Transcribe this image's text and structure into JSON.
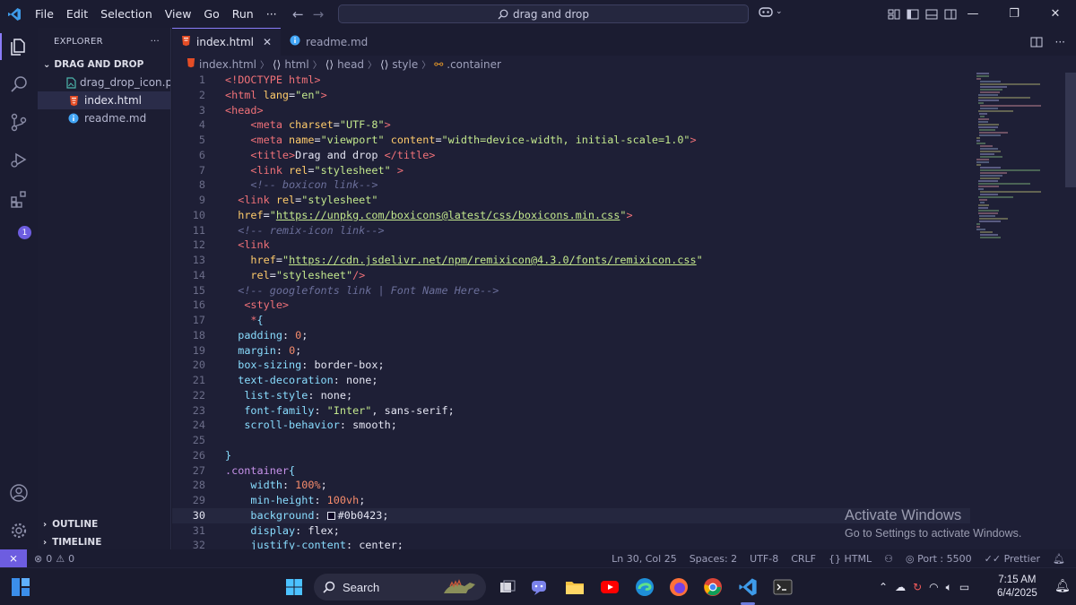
{
  "window": {
    "menu": [
      "File",
      "Edit",
      "Selection",
      "View",
      "Go",
      "Run",
      "···"
    ],
    "search_text": "drag and drop",
    "controls": [
      "—",
      "❐",
      "✕"
    ]
  },
  "explorer": {
    "title": "EXPLORER",
    "more": "···",
    "folder": "DRAG AND DROP",
    "files": [
      {
        "name": "drag_drop_icon.p...",
        "icon": "image-file-icon",
        "active": false
      },
      {
        "name": "index.html",
        "icon": "html-file-icon",
        "active": true
      },
      {
        "name": "readme.md",
        "icon": "info-file-icon",
        "active": false
      }
    ],
    "outline": "OUTLINE",
    "timeline": "TIMELINE",
    "extensions_badge": "1"
  },
  "tabs": [
    {
      "label": "index.html",
      "active": true
    },
    {
      "label": "readme.md",
      "active": false
    }
  ],
  "breadcrumb": [
    "index.html",
    "html",
    "head",
    "style",
    ".container"
  ],
  "editor": {
    "current_line": 30,
    "lines": [
      {
        "n": "1",
        "t": [
          [
            "t-tag",
            "<!DOCTYPE html>"
          ]
        ]
      },
      {
        "n": "2",
        "t": [
          [
            "t-tag",
            "<html "
          ],
          [
            "t-attr",
            "lang"
          ],
          [
            "t-txt",
            "="
          ],
          [
            "t-str",
            "\"en\""
          ],
          [
            "t-tag",
            ">"
          ]
        ]
      },
      {
        "n": "3",
        "t": [
          [
            "t-tag",
            "<head>"
          ]
        ]
      },
      {
        "n": "4",
        "t": [
          [
            "t-txt",
            "    "
          ],
          [
            "t-tag",
            "<meta "
          ],
          [
            "t-attr",
            "charset"
          ],
          [
            "t-txt",
            "="
          ],
          [
            "t-str",
            "\"UTF-8\""
          ],
          [
            "t-tag",
            ">"
          ]
        ]
      },
      {
        "n": "5",
        "t": [
          [
            "t-txt",
            "    "
          ],
          [
            "t-tag",
            "<meta "
          ],
          [
            "t-attr",
            "name"
          ],
          [
            "t-txt",
            "="
          ],
          [
            "t-str",
            "\"viewport\""
          ],
          [
            "t-txt",
            " "
          ],
          [
            "t-attr",
            "content"
          ],
          [
            "t-txt",
            "="
          ],
          [
            "t-str",
            "\"width=device-width, initial-scale=1.0\""
          ],
          [
            "t-tag",
            ">"
          ]
        ]
      },
      {
        "n": "6",
        "t": [
          [
            "t-txt",
            "    "
          ],
          [
            "t-tag",
            "<title>"
          ],
          [
            "t-txt",
            "Drag and drop "
          ],
          [
            "t-tag",
            "</title>"
          ]
        ]
      },
      {
        "n": "7",
        "t": [
          [
            "t-txt",
            "    "
          ],
          [
            "t-tag",
            "<link "
          ],
          [
            "t-attr",
            "rel"
          ],
          [
            "t-txt",
            "="
          ],
          [
            "t-str",
            "\"stylesheet\""
          ],
          [
            "t-txt",
            " "
          ],
          [
            "t-tag",
            ">"
          ]
        ]
      },
      {
        "n": "8",
        "t": [
          [
            "t-txt",
            "    "
          ],
          [
            "t-cmt",
            "<!-- boxicon link-->"
          ]
        ]
      },
      {
        "n": "9",
        "t": [
          [
            "t-txt",
            "  "
          ],
          [
            "t-tag",
            "<link "
          ],
          [
            "t-attr",
            "rel"
          ],
          [
            "t-txt",
            "="
          ],
          [
            "t-str",
            "\"stylesheet\""
          ]
        ]
      },
      {
        "n": "10",
        "t": [
          [
            "t-txt",
            "  "
          ],
          [
            "t-attr",
            "href"
          ],
          [
            "t-txt",
            "="
          ],
          [
            "t-str",
            "\""
          ],
          [
            "t-url",
            "https://unpkg.com/boxicons@latest/css/boxicons.min.css"
          ],
          [
            "t-str",
            "\""
          ],
          [
            "t-tag",
            ">"
          ]
        ]
      },
      {
        "n": "11",
        "t": [
          [
            "t-txt",
            "  "
          ],
          [
            "t-cmt",
            "<!-- remix-icon link-->"
          ]
        ]
      },
      {
        "n": "12",
        "t": [
          [
            "t-txt",
            "  "
          ],
          [
            "t-tag",
            "<link"
          ]
        ]
      },
      {
        "n": "13",
        "t": [
          [
            "t-txt",
            "    "
          ],
          [
            "t-attr",
            "href"
          ],
          [
            "t-txt",
            "="
          ],
          [
            "t-str",
            "\""
          ],
          [
            "t-url",
            "https://cdn.jsdelivr.net/npm/remixicon@4.3.0/fonts/remixicon.css"
          ],
          [
            "t-str",
            "\""
          ]
        ]
      },
      {
        "n": "14",
        "t": [
          [
            "t-txt",
            "    "
          ],
          [
            "t-attr",
            "rel"
          ],
          [
            "t-txt",
            "="
          ],
          [
            "t-str",
            "\"stylesheet\""
          ],
          [
            "t-tag",
            "/>"
          ]
        ]
      },
      {
        "n": "15",
        "t": [
          [
            "t-txt",
            "  "
          ],
          [
            "t-cmt",
            "<!-- googlefonts link | Font Name Here-->"
          ]
        ]
      },
      {
        "n": "16",
        "t": [
          [
            "t-txt",
            "   "
          ],
          [
            "t-tag",
            "<style>"
          ]
        ]
      },
      {
        "n": "17",
        "t": [
          [
            "t-txt",
            "    "
          ],
          [
            "t-tag",
            "*"
          ],
          [
            "t-punc",
            "{"
          ]
        ]
      },
      {
        "n": "18",
        "t": [
          [
            "t-txt",
            "  "
          ],
          [
            "t-prop",
            "padding"
          ],
          [
            "t-txt",
            ": "
          ],
          [
            "t-val",
            "0"
          ],
          [
            "t-txt",
            ";"
          ]
        ]
      },
      {
        "n": "19",
        "t": [
          [
            "t-txt",
            "  "
          ],
          [
            "t-prop",
            "margin"
          ],
          [
            "t-txt",
            ": "
          ],
          [
            "t-val",
            "0"
          ],
          [
            "t-txt",
            ";"
          ]
        ]
      },
      {
        "n": "20",
        "t": [
          [
            "t-txt",
            "  "
          ],
          [
            "t-prop",
            "box-sizing"
          ],
          [
            "t-txt",
            ": "
          ],
          [
            "t-txt",
            "border-box;"
          ]
        ]
      },
      {
        "n": "21",
        "t": [
          [
            "t-txt",
            "  "
          ],
          [
            "t-prop",
            "text-decoration"
          ],
          [
            "t-txt",
            ": "
          ],
          [
            "t-txt",
            "none;"
          ]
        ]
      },
      {
        "n": "22",
        "t": [
          [
            "t-txt",
            "   "
          ],
          [
            "t-prop",
            "list-style"
          ],
          [
            "t-txt",
            ": "
          ],
          [
            "t-txt",
            "none;"
          ]
        ]
      },
      {
        "n": "23",
        "t": [
          [
            "t-txt",
            "   "
          ],
          [
            "t-prop",
            "font-family"
          ],
          [
            "t-txt",
            ": "
          ],
          [
            "t-str",
            "\"Inter\""
          ],
          [
            "t-txt",
            ", sans-serif;"
          ]
        ]
      },
      {
        "n": "24",
        "t": [
          [
            "t-txt",
            "   "
          ],
          [
            "t-prop",
            "scroll-behavior"
          ],
          [
            "t-txt",
            ": "
          ],
          [
            "t-txt",
            "smooth;"
          ]
        ]
      },
      {
        "n": "25",
        "t": []
      },
      {
        "n": "26",
        "t": [
          [
            "t-punc",
            "}"
          ]
        ]
      },
      {
        "n": "27",
        "t": [
          [
            "t-sel",
            ".container"
          ],
          [
            "t-punc",
            "{"
          ]
        ]
      },
      {
        "n": "28",
        "t": [
          [
            "t-txt",
            "    "
          ],
          [
            "t-prop",
            "width"
          ],
          [
            "t-txt",
            ": "
          ],
          [
            "t-val",
            "100%"
          ],
          [
            "t-txt",
            ";"
          ]
        ]
      },
      {
        "n": "29",
        "t": [
          [
            "t-txt",
            "    "
          ],
          [
            "t-prop",
            "min-height"
          ],
          [
            "t-txt",
            ": "
          ],
          [
            "t-val",
            "100vh"
          ],
          [
            "t-txt",
            ";"
          ]
        ]
      },
      {
        "n": "30",
        "t": [
          [
            "t-txt",
            "    "
          ],
          [
            "t-prop",
            "background"
          ],
          [
            "t-txt",
            ": "
          ],
          [
            "swatch",
            ""
          ],
          [
            "t-txt",
            "#0b0423;"
          ]
        ]
      },
      {
        "n": "31",
        "t": [
          [
            "t-txt",
            "    "
          ],
          [
            "t-prop",
            "display"
          ],
          [
            "t-txt",
            ": "
          ],
          [
            "t-txt",
            "flex;"
          ]
        ]
      },
      {
        "n": "32",
        "t": [
          [
            "t-txt",
            "    "
          ],
          [
            "t-prop",
            "justify-content"
          ],
          [
            "t-txt",
            ": "
          ],
          [
            "t-txt",
            "center;"
          ]
        ]
      }
    ]
  },
  "watermark": {
    "title": "Activate Windows",
    "subtitle": "Go to Settings to activate Windows."
  },
  "status": {
    "errors": "0",
    "warnings": "0",
    "position": "Ln 30, Col 25",
    "spaces": "Spaces: 2",
    "encoding": "UTF-8",
    "eol": "CRLF",
    "language": "HTML",
    "port": "Port : 5500",
    "formatter": "Prettier"
  },
  "taskbar": {
    "search": "Search",
    "time": "7:15 AM",
    "date": "6/4/2025"
  },
  "colors": {
    "accent": "#6d5de0",
    "editor_bg": "#1e1f36",
    "sidebar_bg": "#1c1d32"
  }
}
